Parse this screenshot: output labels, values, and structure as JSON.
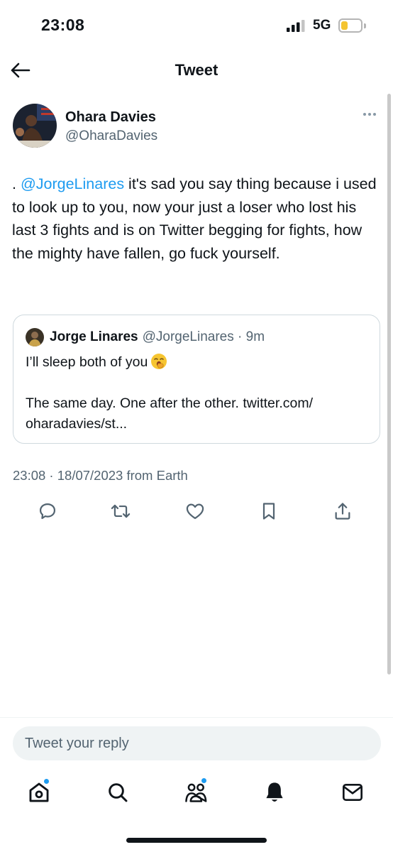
{
  "status_bar": {
    "time": "23:08",
    "network": "5G",
    "signal_icon": "cellular-signal-icon",
    "battery_icon": "battery-icon",
    "battery_color": "#f4c430"
  },
  "header": {
    "title": "Tweet",
    "back_icon": "arrow-left-icon"
  },
  "tweet": {
    "author_name": "Ohara Davies",
    "author_handle": "@OharaDavies",
    "text_prefix": ". ",
    "mention": "@JorgeLinares",
    "text_body": " it's sad you say thing because i used to look up to you, now your just a loser who lost his last 3 fights and is on Twitter begging for fights, how the mighty have fallen, go fuck yourself.",
    "timestamp": "23:08 · 18/07/2023 from Earth",
    "link_color": "#1d9bf0"
  },
  "quoted_tweet": {
    "author_name": "Jorge Linares",
    "author_handle": "@JorgeLinares · 9m",
    "line1": "I’ll sleep both of you",
    "emoji_icon": "yawning-face-emoji-icon",
    "line2": "The same day. One after the other. twitter.com/",
    "line3": "oharadavies/st..."
  },
  "actions": [
    "reply-icon",
    "retweet-icon",
    "like-icon",
    "bookmark-icon",
    "share-icon"
  ],
  "reply": {
    "placeholder": "Tweet your reply"
  },
  "bottom_nav": [
    "home-icon",
    "search-icon",
    "communities-icon",
    "notifications-icon",
    "messages-icon"
  ]
}
